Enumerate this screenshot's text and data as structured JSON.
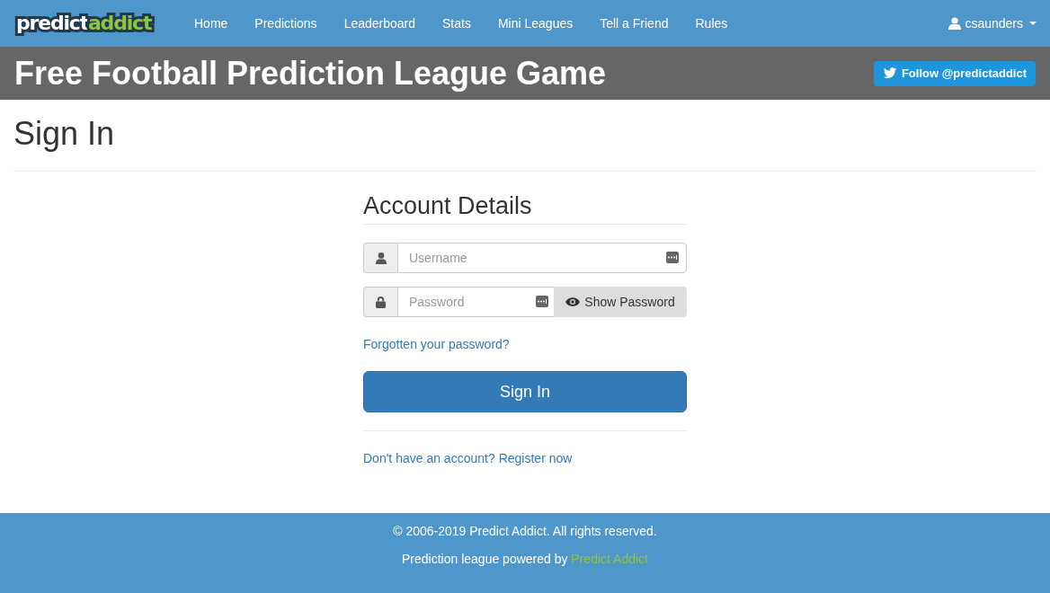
{
  "navbar": {
    "logo": {
      "word_1": "predict",
      "word_2": "addict"
    },
    "links": [
      "Home",
      "Predictions",
      "Leaderboard",
      "Stats",
      "Mini Leagues",
      "Tell a Friend",
      "Rules"
    ],
    "user_menu": {
      "username": "csaunders"
    }
  },
  "banner": {
    "title": "Free Football Prediction League Game",
    "follow_button": "Follow @predictaddict"
  },
  "page": {
    "title": "Sign In"
  },
  "form": {
    "heading": "Account Details",
    "username": {
      "placeholder": "Username"
    },
    "password": {
      "placeholder": "Password"
    },
    "show_password_button": "Show Password",
    "forgot_link": "Forgotten your password?",
    "submit_button": "Sign In",
    "register_prompt": "Don't have an account?",
    "register_link": "Register now"
  },
  "footer": {
    "copyright": "© 2006-2019 Predict Addict. All rights reserved.",
    "powered_by": "Prediction league powered by",
    "powered_by_link": "Predict Addict"
  }
}
